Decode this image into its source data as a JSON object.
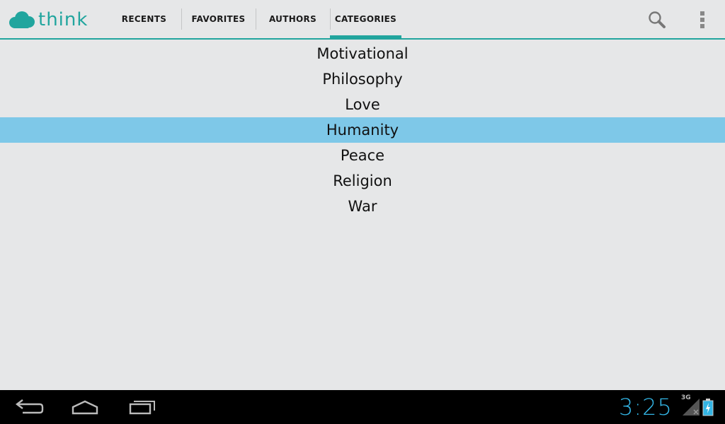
{
  "app": {
    "logo_text": "think",
    "brand_color": "#21a59e",
    "selection_color": "#7ec8e8"
  },
  "tabs": [
    {
      "label": "RECENTS",
      "active": false
    },
    {
      "label": "FAVORITES",
      "active": false
    },
    {
      "label": "AUTHORS",
      "active": false
    },
    {
      "label": "CATEGORIES",
      "active": true
    }
  ],
  "actions": {
    "search_icon": "search-icon",
    "overflow_icon": "overflow-menu-icon"
  },
  "categories": [
    {
      "label": "Motivational",
      "selected": false
    },
    {
      "label": "Philosophy",
      "selected": false
    },
    {
      "label": "Love",
      "selected": false
    },
    {
      "label": "Humanity",
      "selected": true
    },
    {
      "label": "Peace",
      "selected": false
    },
    {
      "label": "Religion",
      "selected": false
    },
    {
      "label": "War",
      "selected": false
    }
  ],
  "system_bar": {
    "time": "3:25",
    "network": "3G",
    "clock_color": "#33b5e5",
    "nav_icons": [
      "back-icon",
      "home-icon",
      "recent-apps-icon"
    ]
  }
}
